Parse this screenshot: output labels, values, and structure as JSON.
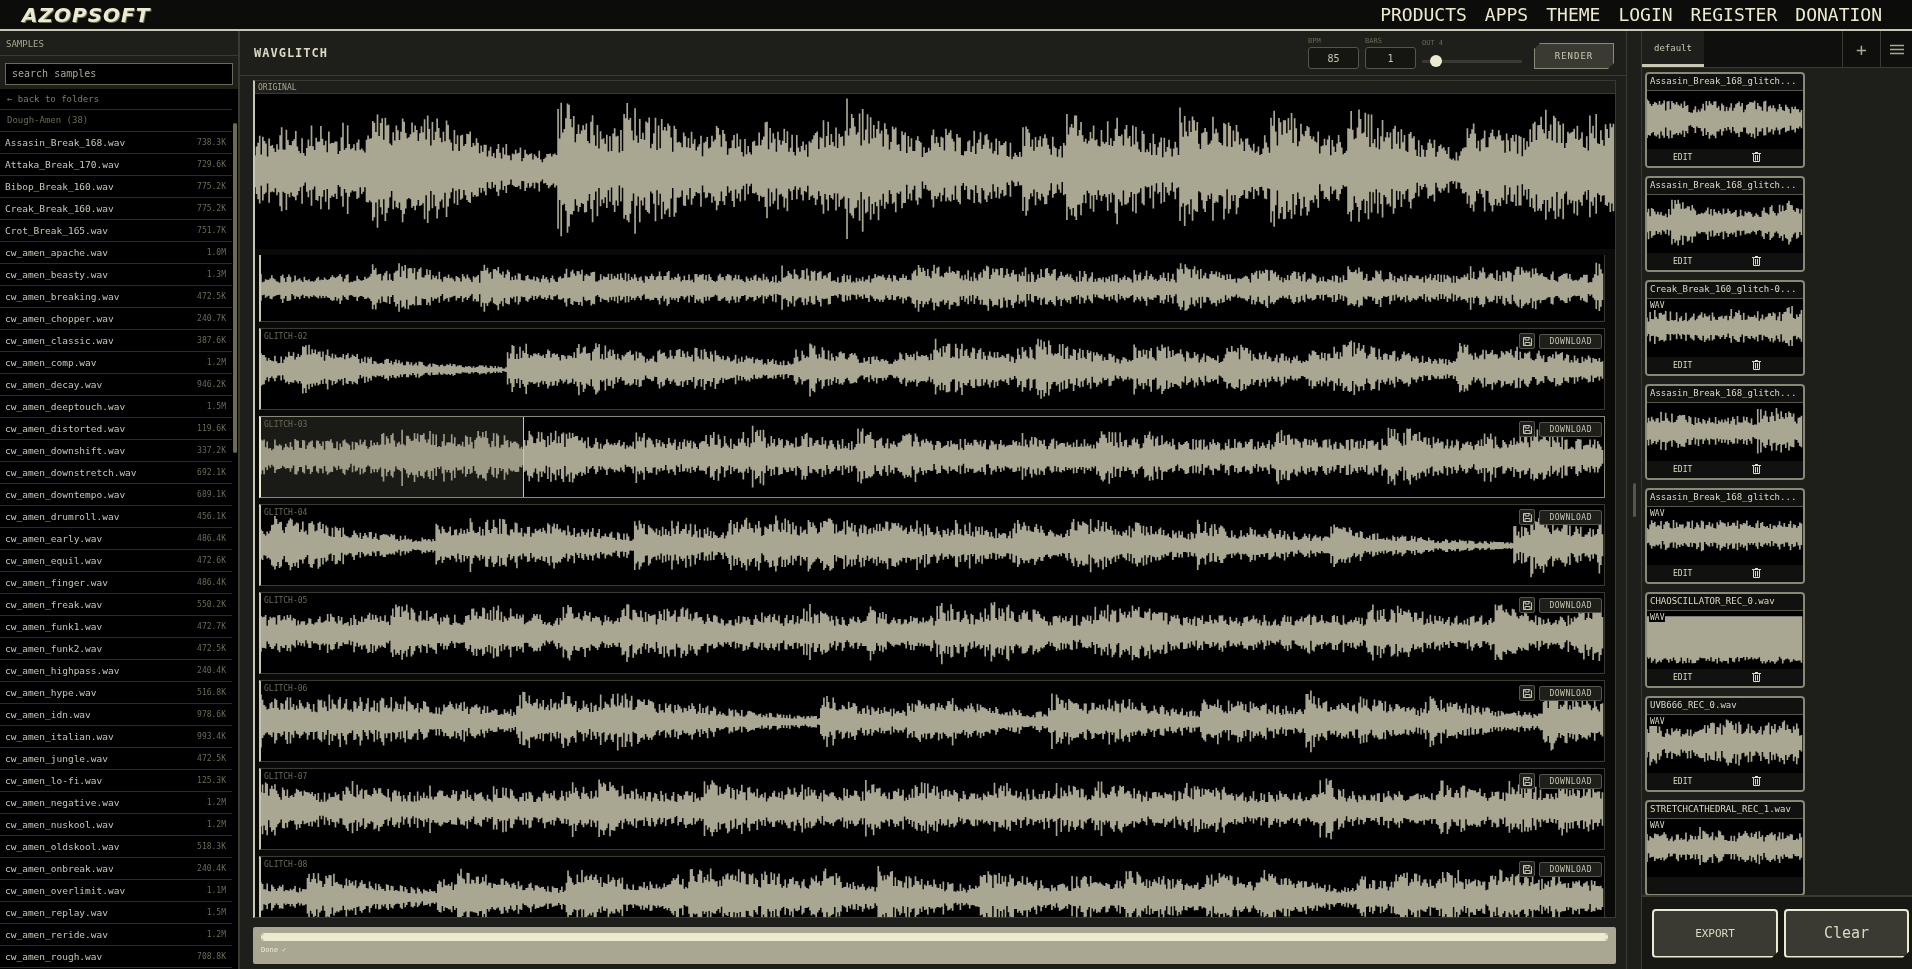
{
  "nav": {
    "logo": "AZOPSOFT",
    "links": [
      "PRODUCTS",
      "APPS",
      "THEME",
      "LOGIN",
      "REGISTER",
      "DONATION"
    ]
  },
  "sidebar": {
    "title": "SAMPLES",
    "search": {
      "placeholder": "search samples"
    },
    "back_link": "← back to folders",
    "folder": "Dough-Amen (38)",
    "items": [
      {
        "name": "Assasin_Break_168.wav",
        "size": "738.3K",
        "selected": false
      },
      {
        "name": "Attaka_Break_170.wav",
        "size": "729.6K",
        "selected": false
      },
      {
        "name": "Bibop_Break_160.wav",
        "size": "775.2K",
        "selected": false
      },
      {
        "name": "Creak_Break_160.wav",
        "size": "775.2K",
        "selected": false
      },
      {
        "name": "Crot_Break_165.wav",
        "size": "751.7K",
        "selected": false
      },
      {
        "name": "cw_amen_apache.wav",
        "size": "1.0M",
        "selected": false
      },
      {
        "name": "cw_amen_beasty.wav",
        "size": "1.3M",
        "selected": false
      },
      {
        "name": "cw_amen_breaking.wav",
        "size": "472.5K",
        "selected": false
      },
      {
        "name": "cw_amen_chopper.wav",
        "size": "240.7K",
        "selected": false
      },
      {
        "name": "cw_amen_classic.wav",
        "size": "387.6K",
        "selected": false
      },
      {
        "name": "cw_amen_comp.wav",
        "size": "1.2M",
        "selected": false
      },
      {
        "name": "cw_amen_decay.wav",
        "size": "946.2K",
        "selected": false
      },
      {
        "name": "cw_amen_deeptouch.wav",
        "size": "1.5M",
        "selected": false
      },
      {
        "name": "cw_amen_distorted.wav",
        "size": "119.6K",
        "selected": false
      },
      {
        "name": "cw_amen_downshift.wav",
        "size": "337.2K",
        "selected": false
      },
      {
        "name": "cw_amen_downstretch.wav",
        "size": "692.1K",
        "selected": false
      },
      {
        "name": "cw_amen_downtempo.wav",
        "size": "689.1K",
        "selected": false
      },
      {
        "name": "cw_amen_drumroll.wav",
        "size": "456.1K",
        "selected": false
      },
      {
        "name": "cw_amen_early.wav",
        "size": "486.4K",
        "selected": false
      },
      {
        "name": "cw_amen_equil.wav",
        "size": "472.6K",
        "selected": false
      },
      {
        "name": "cw_amen_finger.wav",
        "size": "486.4K",
        "selected": false
      },
      {
        "name": "cw_amen_freak.wav",
        "size": "550.2K",
        "selected": false
      },
      {
        "name": "cw_amen_funk1.wav",
        "size": "472.7K",
        "selected": false
      },
      {
        "name": "cw_amen_funk2.wav",
        "size": "472.5K",
        "selected": false
      },
      {
        "name": "cw_amen_highpass.wav",
        "size": "240.4K",
        "selected": false
      },
      {
        "name": "cw_amen_hype.wav",
        "size": "516.8K",
        "selected": false
      },
      {
        "name": "cw_amen_idn.wav",
        "size": "978.6K",
        "selected": false
      },
      {
        "name": "cw_amen_italian.wav",
        "size": "993.4K",
        "selected": false
      },
      {
        "name": "cw_amen_jungle.wav",
        "size": "472.5K",
        "selected": false
      },
      {
        "name": "cw_amen_lo-fi.wav",
        "size": "125.3K",
        "selected": false
      },
      {
        "name": "cw_amen_negative.wav",
        "size": "1.2M",
        "selected": false
      },
      {
        "name": "cw_amen_nuskool.wav",
        "size": "1.2M",
        "selected": false
      },
      {
        "name": "cw_amen_oldskool.wav",
        "size": "518.3K",
        "selected": false
      },
      {
        "name": "cw_amen_onbreak.wav",
        "size": "240.4K",
        "selected": false
      },
      {
        "name": "cw_amen_overlimit.wav",
        "size": "1.1M",
        "selected": false
      },
      {
        "name": "cw_amen_replay.wav",
        "size": "1.5M",
        "selected": false
      },
      {
        "name": "cw_amen_reride.wav",
        "size": "1.2M",
        "selected": false
      },
      {
        "name": "cw_amen_rough.wav",
        "size": "708.8K",
        "selected": false
      }
    ]
  },
  "editor": {
    "title": "WAVGLITCH",
    "bpm": {
      "label": "BPM",
      "value": "85"
    },
    "bars": {
      "label": "BARS",
      "value": "1"
    },
    "out": {
      "label": "OUT 4",
      "level": 0.14
    },
    "render_button": "RENDER",
    "tracks": [
      {
        "kind": "original",
        "label": "ORIGINAL",
        "selected": false
      },
      {
        "kind": "glitch",
        "selected": false
      },
      {
        "kind": "glitch",
        "label": "GLITCH-02",
        "download": "DOWNLOAD",
        "selected": false
      },
      {
        "kind": "glitch",
        "label": "GLITCH-03",
        "download": "DOWNLOAD",
        "selected": true
      },
      {
        "kind": "glitch",
        "label": "GLITCH-04",
        "download": "DOWNLOAD",
        "selected": false
      },
      {
        "kind": "glitch",
        "label": "GLITCH-05",
        "download": "DOWNLOAD",
        "selected": false
      },
      {
        "kind": "glitch",
        "label": "GLITCH-06",
        "download": "DOWNLOAD",
        "selected": false
      },
      {
        "kind": "glitch",
        "label": "GLITCH-07",
        "download": "DOWNLOAD",
        "selected": false
      },
      {
        "kind": "glitch",
        "label": "GLITCH-08",
        "download": "DOWNLOAD",
        "selected": false
      }
    ],
    "progress": {
      "level": 1,
      "status": "Done ✓"
    }
  },
  "library": {
    "tabs": [
      {
        "label": "default",
        "selected": true
      }
    ],
    "add": "+",
    "cards": [
      {
        "title": "Assasin_Break_168_glitch...",
        "edit": "EDIT"
      },
      {
        "title": "Assasin_Break_168_glitch...",
        "edit": "EDIT"
      },
      {
        "title": "Creak_Break_160_glitch-0...",
        "badge": "WAV",
        "edit": "EDIT"
      },
      {
        "title": "Assasin_Break_168_glitch...",
        "edit": "EDIT"
      },
      {
        "title": "Assasin_Break_168_glitch...",
        "badge": "WAV",
        "edit": "EDIT"
      },
      {
        "title": "CHAOSCILLATOR_REC_0.wav",
        "badge": "WAV",
        "edit": "EDIT"
      },
      {
        "title": "UVB666_REC_0.wav",
        "badge": "WAV",
        "edit": "EDIT"
      },
      {
        "title": "STRETCHCATHEDRAL_REC_1.wav",
        "badge": "WAV"
      }
    ],
    "export_button": "EXPORT",
    "clear_button": "Clear"
  }
}
